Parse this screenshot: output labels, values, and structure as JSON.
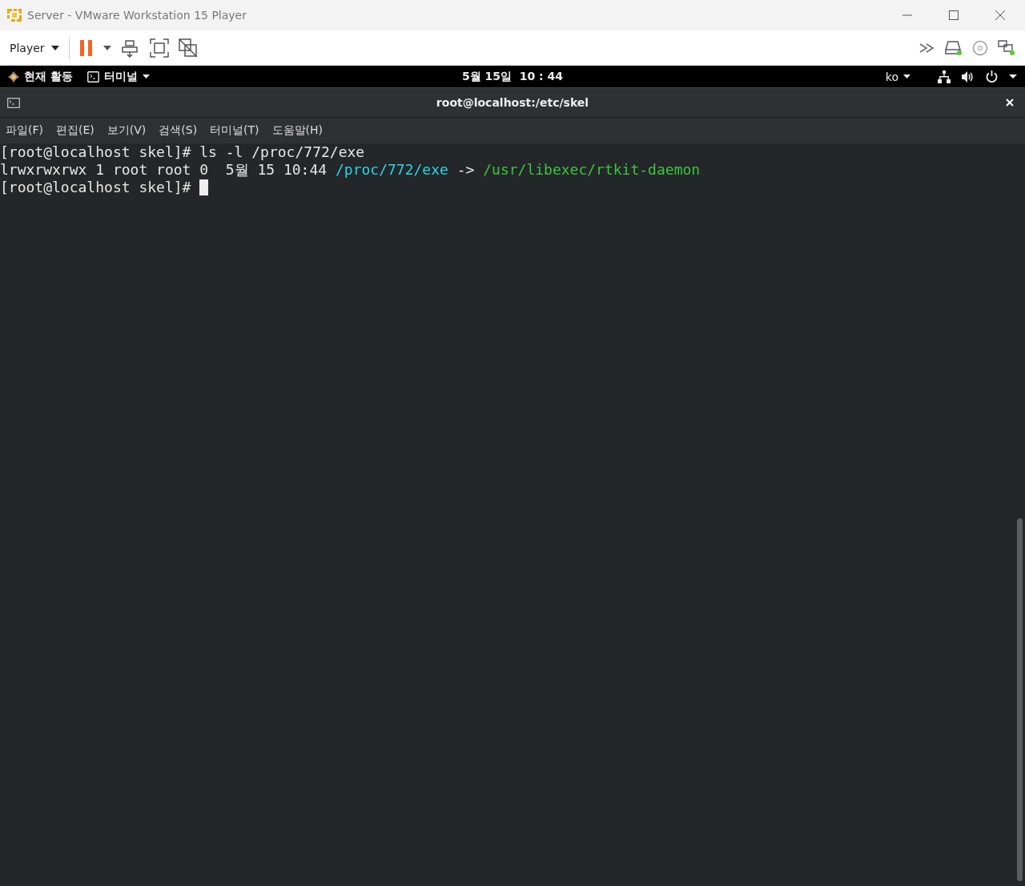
{
  "window": {
    "title": "Server - VMware Workstation 15 Player"
  },
  "toolbar": {
    "player_menu": "Player"
  },
  "top_bar": {
    "activities": "현재 활동",
    "app_menu": "터미널",
    "clock": "5월 15일  10 : 44",
    "input_method": "ko"
  },
  "terminal": {
    "title": "root@localhost:/etc/skel",
    "menu": [
      "파일(F)",
      "편집(E)",
      "보기(V)",
      "검색(S)",
      "터미널(T)",
      "도움말(H)"
    ],
    "lines": [
      {
        "cursor": false,
        "segments": [
          {
            "kind": "plain",
            "text": "[root@localhost skel]# ls -l /proc/772/exe"
          }
        ]
      },
      {
        "cursor": false,
        "segments": [
          {
            "kind": "plain",
            "text": "lrwxrwxrwx 1 root root 0  5월 15 10:44 "
          },
          {
            "kind": "symlink",
            "text": "/proc/772/exe"
          },
          {
            "kind": "plain",
            "text": " -> "
          },
          {
            "kind": "target",
            "text": "/usr/libexec/rtkit-daemon"
          }
        ]
      },
      {
        "cursor": true,
        "segments": [
          {
            "kind": "plain",
            "text": "[root@localhost skel]# "
          }
        ]
      }
    ]
  }
}
